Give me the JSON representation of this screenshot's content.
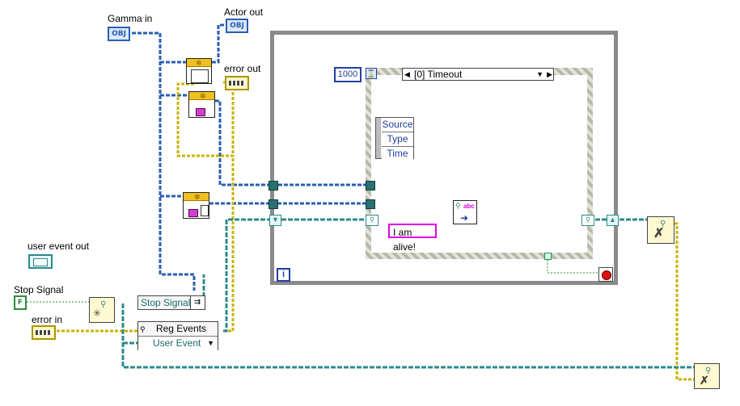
{
  "labels": {
    "gamma_in": "Gamma in",
    "actor_out": "Actor out",
    "error_out": "error out",
    "user_event_out": "user event out",
    "stop_signal": "Stop Signal",
    "error_in": "error in"
  },
  "terminals": {
    "gamma_in_tag": "OBJ",
    "actor_out_tag": "OBJ",
    "stop_signal_tag": "F"
  },
  "loop": {
    "timeout_constant": "1000",
    "event_case_selector": "[0] Timeout",
    "iteration_terminal": "i"
  },
  "property_node": {
    "rows": [
      "Source",
      "Type",
      "Time"
    ]
  },
  "string_constant": "I am alive!",
  "stop_signal_node": "Stop Signal",
  "reg_events": {
    "title": "Reg Events",
    "item": "User Event"
  },
  "colors": {
    "refnum_wire": "#2a5fb0",
    "error_wire": "#c8b400",
    "event_wire": "#2e8a8a",
    "string_wire": "#e000e0",
    "loop_border": "#8a8a8a"
  }
}
